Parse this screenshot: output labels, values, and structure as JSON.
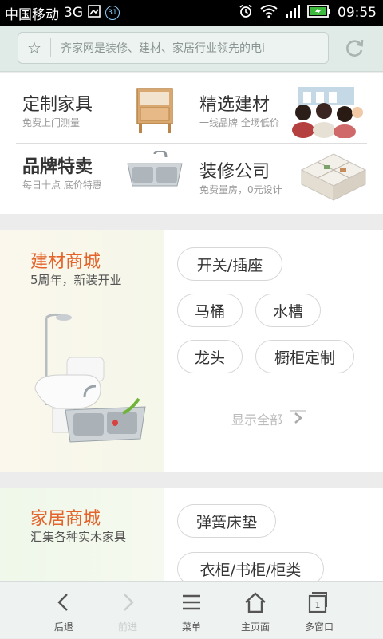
{
  "status_bar": {
    "carrier": "中国移动",
    "network": "3G",
    "calendar_badge": "31",
    "time": "09:55"
  },
  "url_bar": {
    "text": "齐家网是装修、建材、家居行业领先的电i"
  },
  "categories": [
    {
      "title": "定制家具",
      "subtitle": "免费上门测量",
      "image": "furniture-cabinet"
    },
    {
      "title": "精选建材",
      "subtitle": "一线品牌 全场低价",
      "image": "people-group"
    },
    {
      "title": "品牌特卖",
      "subtitle": "每日十点 底价特惠",
      "image": "kitchen-sink"
    },
    {
      "title": "装修公司",
      "subtitle": "免费量房，0元设计",
      "image": "floor-plan-3d"
    }
  ],
  "building_materials": {
    "title": "建材商城",
    "subtitle": "5周年，新装开业",
    "tags": [
      "开关/插座",
      "马桶",
      "水槽",
      "龙头",
      "橱柜定制"
    ],
    "show_all": "显示全部"
  },
  "home_furnishing": {
    "title": "家居商城",
    "subtitle": "汇集各种实木家具",
    "tags": [
      "弹簧床垫",
      "衣柜/书柜/柜类"
    ]
  },
  "bottom_nav": [
    {
      "label": "后退",
      "icon": "back-icon"
    },
    {
      "label": "前进",
      "icon": "forward-icon"
    },
    {
      "label": "菜单",
      "icon": "menu-icon"
    },
    {
      "label": "主页面",
      "icon": "home-icon"
    },
    {
      "label": "多窗口",
      "icon": "windows-icon",
      "count": "1"
    }
  ],
  "colors": {
    "accent": "#e4632a",
    "status_bar": "#000000",
    "url_bar_bg": "#e0ebe8"
  }
}
